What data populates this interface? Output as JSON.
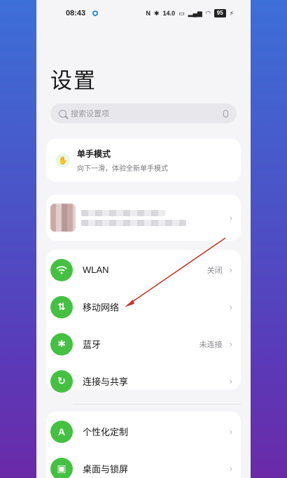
{
  "status": {
    "time": "08:43",
    "net_speed_top": "14.0",
    "net_speed_unit": "KB/S",
    "battery": "95"
  },
  "page": {
    "title": "设置"
  },
  "search": {
    "placeholder": "搜索设置项"
  },
  "one_hand": {
    "title": "单手模式",
    "subtitle": "向下一滑，体验全新单手模式"
  },
  "list": [
    {
      "label": "WLAN",
      "value": "关闭",
      "icon": "wifi-icon"
    },
    {
      "label": "移动网络",
      "value": "",
      "icon": "mobile-data-icon"
    },
    {
      "label": "蓝牙",
      "value": "未连接",
      "icon": "bluetooth-icon"
    },
    {
      "label": "连接与共享",
      "value": "",
      "icon": "share-icon"
    }
  ],
  "list2": [
    {
      "label": "个性化定制",
      "value": "",
      "icon": "personalize-icon"
    },
    {
      "label": "桌面与锁屏",
      "value": "",
      "icon": "wallpaper-icon"
    }
  ],
  "colors": {
    "accent": "#46c042",
    "annotation_arrow": "#c0392b"
  }
}
